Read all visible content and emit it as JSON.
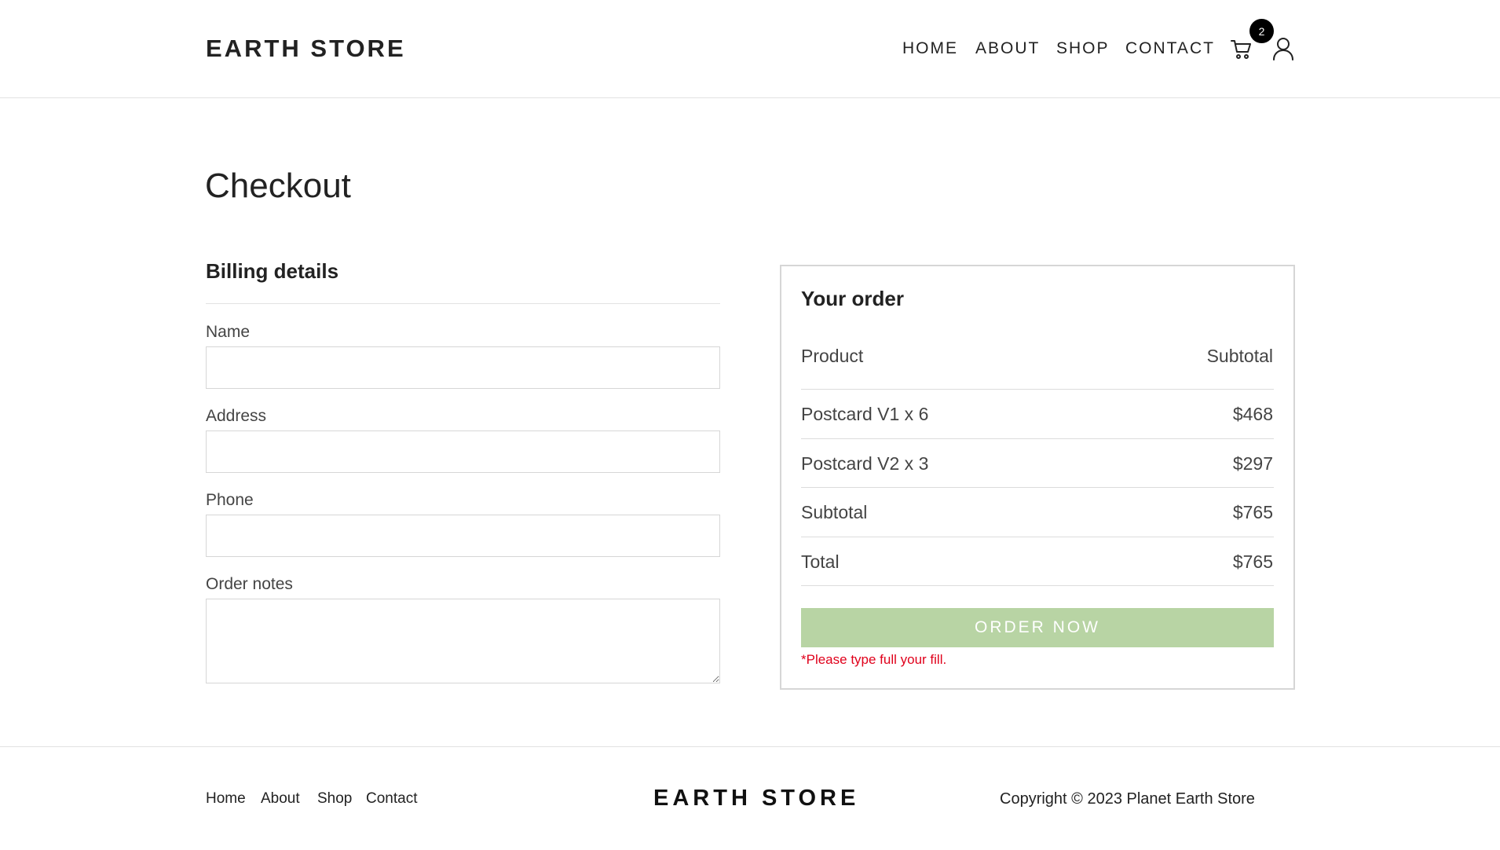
{
  "header": {
    "brand": "EARTH STORE",
    "nav": [
      {
        "label": "HOME"
      },
      {
        "label": "ABOUT"
      },
      {
        "label": "SHOP"
      },
      {
        "label": "CONTACT"
      }
    ],
    "cart_icon": "cart-icon",
    "cart_count": "2",
    "user_icon": "user-icon"
  },
  "page_title": "Checkout",
  "billing": {
    "title": "Billing details",
    "fields": [
      {
        "label": "Name",
        "value": "",
        "placeholder": ""
      },
      {
        "label": "Address",
        "value": "",
        "placeholder": ""
      },
      {
        "label": "Phone",
        "value": "",
        "placeholder": ""
      },
      {
        "label": "Order notes",
        "value": "",
        "placeholder": ""
      }
    ]
  },
  "order": {
    "title": "Your order",
    "col_product": "Product",
    "col_subtotal": "Subtotal",
    "items": [
      {
        "name": "Postcard V1 x 6",
        "amount": "$468"
      },
      {
        "name": "Postcard V2 x 3",
        "amount": "$297"
      }
    ],
    "subtotal_label": "Subtotal",
    "subtotal_value": "$765",
    "total_label": "Total",
    "total_value": "$765",
    "button_label": "ORDER NOW",
    "warning": "*Please type full your fill."
  },
  "footer": {
    "links": [
      {
        "label": "Home"
      },
      {
        "label": "About"
      },
      {
        "label": "Shop"
      },
      {
        "label": "Contact"
      }
    ],
    "brand": "EARTH STORE",
    "copyright": "Copyright © 2023 Planet Earth Store"
  },
  "colors": {
    "accent_button": "#b8d4a4",
    "warning": "#e0001b",
    "badge": "#000000"
  }
}
